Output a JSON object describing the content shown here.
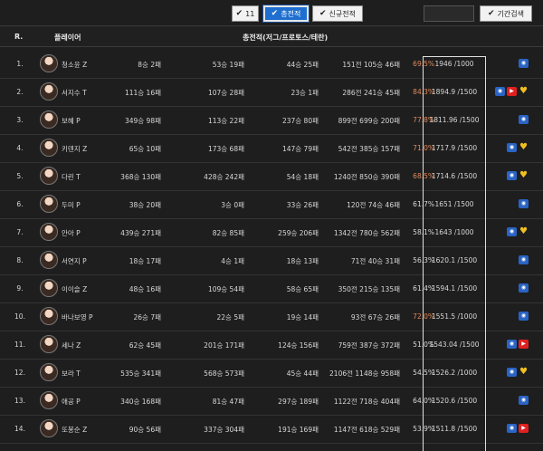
{
  "toolbar": {
    "buttons": [
      {
        "label": "11",
        "icon": "check-icon"
      },
      {
        "label": "총전적",
        "icon": "check-icon",
        "active": true
      },
      {
        "label": "신규전적",
        "icon": "check-icon"
      },
      {
        "label": "기간검색",
        "icon": "check-icon"
      }
    ]
  },
  "table": {
    "headers": {
      "rank": "R.",
      "player": "플레이어",
      "record": "총전적(저그/프로토스/테란)"
    },
    "rows": [
      {
        "rank": "1.",
        "name": "청소윤 Z",
        "c1": "8승 2패",
        "c2": "53승 19패",
        "c3": "44승 25패",
        "c4": "151전 105승 46패",
        "pct": "69.5%",
        "score": "1946 /1000",
        "hi": true,
        "badges": [
          "afreeca"
        ]
      },
      {
        "rank": "2.",
        "name": "서지수 T",
        "c1": "111승 16패",
        "c2": "107승 28패",
        "c3": "23승 1패",
        "c4": "286전 241승 45패",
        "pct": "84.3%",
        "score": "1894.9 /1500",
        "hi": true,
        "badges": [
          "afreeca",
          "youtube",
          "heart"
        ]
      },
      {
        "rank": "3.",
        "name": "보혜 P",
        "c1": "349승 98패",
        "c2": "113승 22패",
        "c3": "237승 80패",
        "c4": "899전 699승 200패",
        "pct": "77.8%",
        "score": "1811.96 /1500",
        "hi": true,
        "badges": [
          "afreeca"
        ]
      },
      {
        "rank": "4.",
        "name": "키덴지 Z",
        "c1": "65승 10패",
        "c2": "173승 68패",
        "c3": "147승 79패",
        "c4": "542전 385승 157패",
        "pct": "71.0%",
        "score": "1717.9 /1500",
        "hi": true,
        "badges": [
          "afreeca",
          "heart"
        ]
      },
      {
        "rank": "5.",
        "name": "다린 T",
        "c1": "368승 130패",
        "c2": "428승 242패",
        "c3": "54승 18패",
        "c4": "1240전 850승 390패",
        "pct": "68.5%",
        "score": "1714.6 /1500",
        "hi": true,
        "badges": [
          "afreeca",
          "heart"
        ]
      },
      {
        "rank": "6.",
        "name": "두미 P",
        "c1": "38승 20패",
        "c2": "3승 0패",
        "c3": "33승 26패",
        "c4": "120전 74승 46패",
        "pct": "61.7%",
        "score": "1651 /1500",
        "hi": false,
        "badges": [
          "afreeca"
        ]
      },
      {
        "rank": "7.",
        "name": "안아 P",
        "c1": "439승 271패",
        "c2": "82승 85패",
        "c3": "259승 206패",
        "c4": "1342전 780승 562패",
        "pct": "58.1%",
        "score": "1643 /1000",
        "hi": false,
        "badges": [
          "afreeca",
          "heart"
        ]
      },
      {
        "rank": "8.",
        "name": "서연지 P",
        "c1": "18승 17패",
        "c2": "4승 1패",
        "c3": "18승 13패",
        "c4": "71전 40승 31패",
        "pct": "56.3%",
        "score": "1620.1 /1500",
        "hi": false,
        "badges": [
          "afreeca"
        ]
      },
      {
        "rank": "9.",
        "name": "이이슬 Z",
        "c1": "48승 16패",
        "c2": "109승 54패",
        "c3": "58승 65패",
        "c4": "350전 215승 135패",
        "pct": "61.4%",
        "score": "1594.1 /1500",
        "hi": false,
        "badges": [
          "afreeca"
        ]
      },
      {
        "rank": "10.",
        "name": "바나보영 P",
        "c1": "26승 7패",
        "c2": "22승 5패",
        "c3": "19승 14패",
        "c4": "93전 67승 26패",
        "pct": "72.0%",
        "score": "1551.5 /1000",
        "hi": true,
        "badges": [
          "afreeca"
        ]
      },
      {
        "rank": "11.",
        "name": "세나 Z",
        "c1": "62승 45패",
        "c2": "201승 171패",
        "c3": "124승 156패",
        "c4": "759전 387승 372패",
        "pct": "51.0%",
        "score": "1543.04 /1500",
        "hi": false,
        "badges": [
          "afreeca",
          "youtube"
        ]
      },
      {
        "rank": "12.",
        "name": "보라 T",
        "c1": "535승 341패",
        "c2": "568승 573패",
        "c3": "45승 44패",
        "c4": "2106전 1148승 958패",
        "pct": "54.5%",
        "score": "1526.2 /1000",
        "hi": false,
        "badges": [
          "afreeca",
          "heart"
        ]
      },
      {
        "rank": "13.",
        "name": "애공 P",
        "c1": "340승 168패",
        "c2": "81승 47패",
        "c3": "297승 189패",
        "c4": "1122전 718승 404패",
        "pct": "64.0%",
        "score": "1520.6 /1500",
        "hi": false,
        "badges": [
          "afreeca"
        ]
      },
      {
        "rank": "14.",
        "name": "또봉순 Z",
        "c1": "90승 56패",
        "c2": "337승 304패",
        "c3": "191승 169패",
        "c4": "1147전 618승 529패",
        "pct": "53.9%",
        "score": "1511.8 /1500",
        "hi": false,
        "badges": [
          "afreeca",
          "youtube"
        ]
      }
    ]
  }
}
